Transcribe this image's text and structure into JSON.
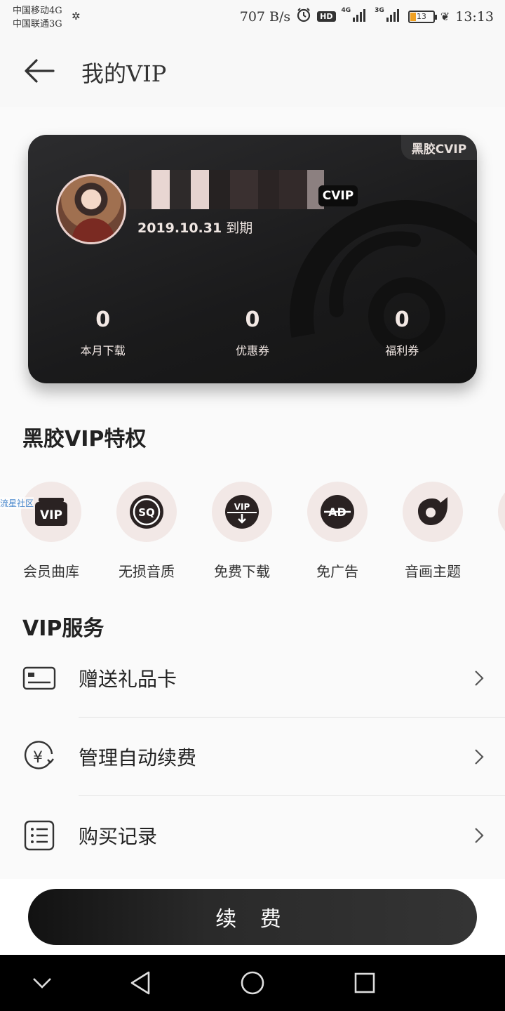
{
  "status_bar": {
    "carrier_1": "中国移动4G",
    "carrier_2": "中国联通3G",
    "net_speed": "707 B/s",
    "hd_label": "HD",
    "net_1": "4G",
    "net_2": "3G",
    "battery": "13",
    "time": "13:13"
  },
  "header": {
    "title": "我的VIP"
  },
  "vip_card": {
    "brand": "黑胶CVIP",
    "badge": "CVIP",
    "expiry_date": "2019.10.31",
    "expiry_suffix": "到期",
    "stats": [
      {
        "value": "0",
        "label": "本月下载"
      },
      {
        "value": "0",
        "label": "优惠券"
      },
      {
        "value": "0",
        "label": "福利券"
      }
    ]
  },
  "privileges": {
    "title": "黑胶VIP特权",
    "watermark": "流星社区",
    "items": [
      {
        "label": "会员曲库",
        "icon": "vip-library-icon"
      },
      {
        "label": "无损音质",
        "icon": "sq-lossless-icon"
      },
      {
        "label": "免费下载",
        "icon": "vip-download-icon"
      },
      {
        "label": "免广告",
        "icon": "no-ad-icon"
      },
      {
        "label": "音画主题",
        "icon": "theme-icon"
      },
      {
        "label": "头",
        "icon": "more-privilege-icon"
      }
    ]
  },
  "services": {
    "title": "VIP服务",
    "items": [
      {
        "label": "赠送礼品卡",
        "icon": "gift-card-icon"
      },
      {
        "label": "管理自动续费",
        "icon": "auto-renew-yen-icon"
      },
      {
        "label": "购买记录",
        "icon": "purchase-list-icon"
      }
    ]
  },
  "renew_button": "续 费",
  "colors": {
    "card_dark": "#1c1c1d",
    "accent_pink": "#f2e8e6",
    "button_dark": "#222222"
  }
}
